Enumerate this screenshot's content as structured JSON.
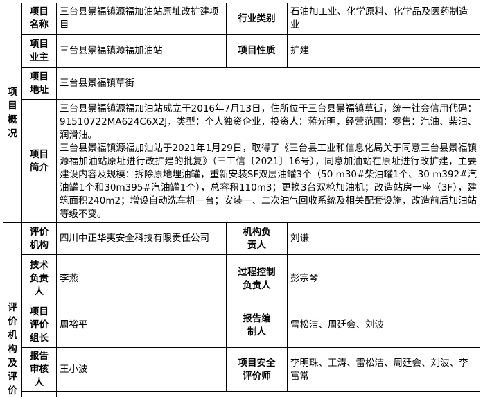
{
  "overview": {
    "section_label": "项目概况",
    "rows": [
      {
        "label": "项目名称",
        "value": "三台县景福镇源福加油站原址改扩建项目",
        "label2": "行业类别",
        "value2": "石油加工业、化学原料、化学品及医药制造业"
      },
      {
        "label": "项目业主",
        "value": "三台县景福镇源福加油站",
        "label2": "项目性质",
        "value2": "扩建"
      },
      {
        "label": "项目地址",
        "value": "三台县景福镇草街"
      }
    ],
    "intro_label": "项目简介",
    "intro_paragraphs": [
      "三台县景福镇源福加油站成立于2016年7月13日，住所位于三台县景福镇草街，统一社会信用代码：91510722MA624C6X2J，类型：个人独资企业，投资人：蒋光明，经营范围：零售：汽油、柴油、润滑油。",
      "三台县景福镇源福加油站于2021年1月29日，取得了《三台县工业和信息化局关于同意三台县景福镇源福加油站原址进行改扩建的批复》（三工信〔2021〕16号），同意加油站在原址进行改扩建，主要建设内容及规模：拆除原地埋油罐，重新安装SF双层油罐3个（50 m30#柴油罐1个、30 m392#汽油罐1个和30m395#汽油罐1个），总容积110m3；更换3台双枪加油机；改造站房一座（3F），建筑面积240m2；增设自动洗车机一台；安装一、二次油气回收系统及相关配套设施，改造前后加油站等级不变。"
    ]
  },
  "evaluation": {
    "section_label": "评价机构及评价",
    "rows": [
      {
        "label": "评价机构",
        "value": "四川中正华夷安全科技有限责任公司",
        "label2": "机构负责人",
        "value2": "刘谦"
      },
      {
        "label": "技术负责人",
        "value": "李燕",
        "label2": "过程控制负责人",
        "value2": "彭宗琴"
      },
      {
        "label": "项目评价组长",
        "value": "周裕平",
        "label2": "报告编制人",
        "value2": "雷松洁、周廷会、刘波"
      },
      {
        "label": "报告审核人",
        "value": "王小波",
        "label2": "项目安全评价师",
        "value2": "李明珠、王涛、雷松洁、周廷会、刘波、李富常"
      }
    ]
  }
}
